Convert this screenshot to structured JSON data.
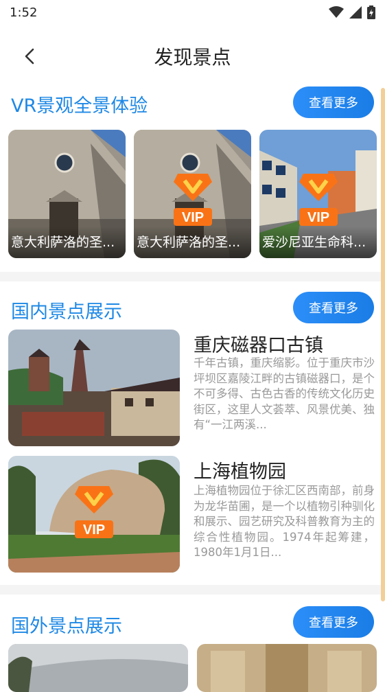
{
  "status": {
    "time": "1:52"
  },
  "header": {
    "title": "发现景点"
  },
  "vr": {
    "title": "VR景观全景体验",
    "more": "查看更多",
    "cards": [
      {
        "caption": "意大利萨洛的圣..."
      },
      {
        "caption": "意大利萨洛的圣..."
      },
      {
        "caption": "爱沙尼亚生命科..."
      }
    ]
  },
  "domestic": {
    "title": "国内景点展示",
    "more": "查看更多",
    "items": [
      {
        "title": "重庆磁器口古镇",
        "desc": "千年古镇，重庆缩影。位于重庆市沙坪坝区嘉陵江畔的古镇磁器口，是个不可多得、古色古香的传统文化历史街区，这里人文荟萃、风景优美、独有“一江两溪..."
      },
      {
        "title": "上海植物园",
        "desc": "上海植物园位于徐汇区西南部，前身为龙华苗圃，是一个以植物引种驯化和展示、园艺研究及科普教育为主的综合性植物园。1974年起筹建，1980年1月1日..."
      }
    ]
  },
  "foreign": {
    "title": "国外景点展示",
    "more": "查看更多"
  },
  "vip_label": "VIP",
  "colors": {
    "accent": "#1e88e5",
    "vip": "#f97316"
  }
}
